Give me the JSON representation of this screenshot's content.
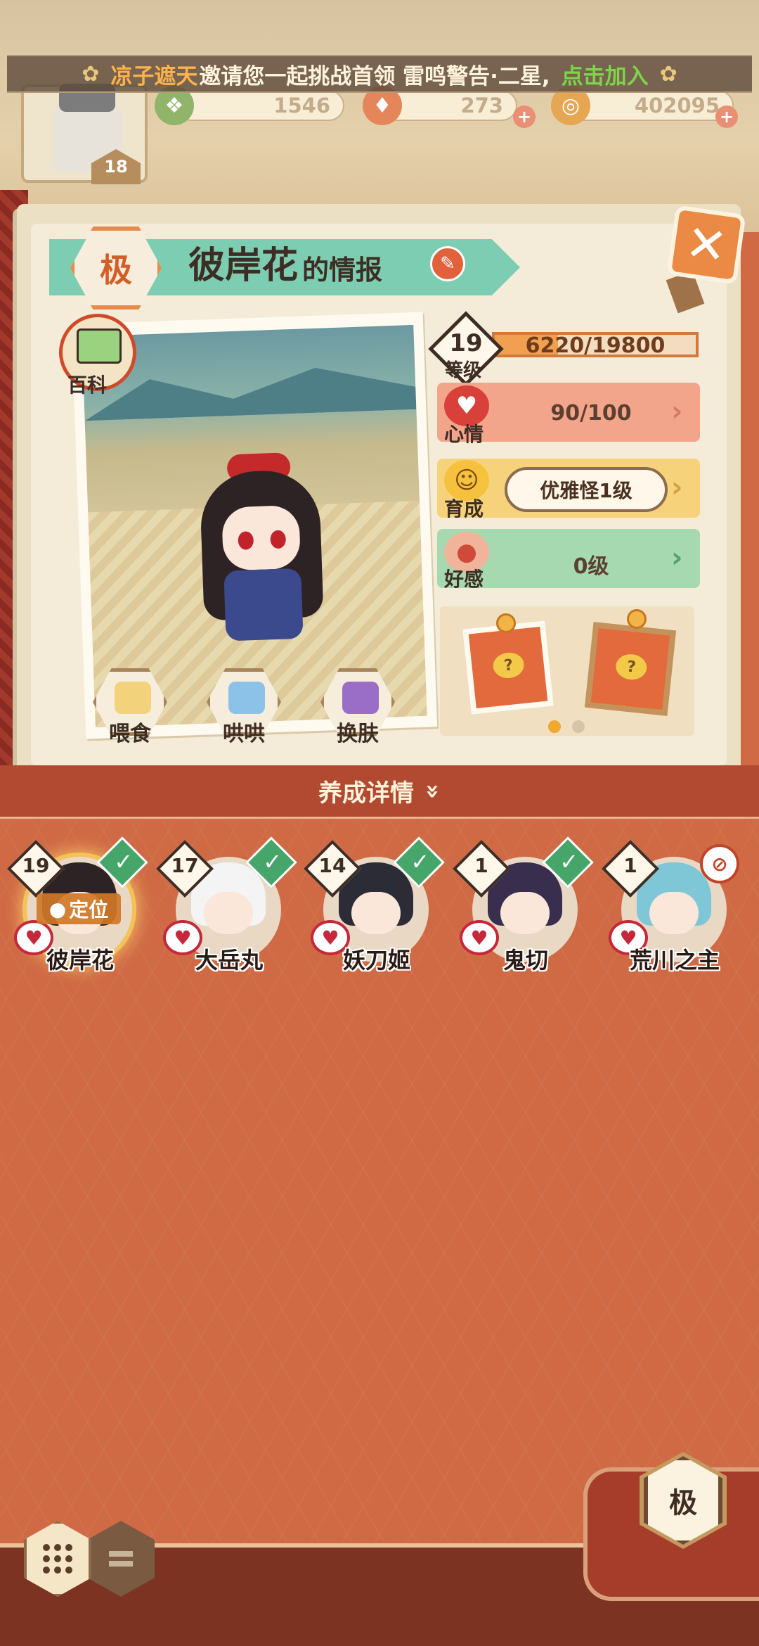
{
  "banner": {
    "inviter": "凉子遮天",
    "message": "邀请您一起挑战首领 雷鸣警告·二星,",
    "action": "点击加入"
  },
  "resources": {
    "player_level": "18",
    "items": [
      {
        "name": "jade",
        "value": "1546",
        "icon": "jade-icon"
      },
      {
        "name": "stamina",
        "value": "273",
        "icon": "stamina-icon"
      },
      {
        "name": "coins",
        "value": "402095",
        "icon": "coin-icon"
      }
    ]
  },
  "profile": {
    "rarity_badge": "极",
    "name": "彼岸花",
    "title_suffix": "的情报",
    "encyclopedia_label": "百科",
    "actions": [
      {
        "label": "喂食",
        "icon": "ramen-icon"
      },
      {
        "label": "哄哄",
        "icon": "milk-icon"
      },
      {
        "label": "换肤",
        "icon": "skin-icon"
      }
    ]
  },
  "stats": {
    "level": "19",
    "level_label": "等级",
    "exp_text": "6220/19800",
    "exp_fraction": 0.314,
    "mood_label": "心情",
    "mood_value": "90/100",
    "nurture_label": "育成",
    "nurture_value": "优雅怪1级",
    "affection_label": "好感",
    "affection_value": "0级",
    "colors": {
      "mood_bg": "#f2a58a",
      "nurture_bg": "#f6d37a",
      "affection_bg": "#a6d9b0"
    }
  },
  "gifts": {
    "page_count": 2,
    "active_page": 0
  },
  "details": {
    "label": "养成详情"
  },
  "roster": [
    {
      "name": "彼岸花",
      "level": "19",
      "status": "check",
      "selected": true,
      "hair": "#2e2324"
    },
    {
      "name": "大岳丸",
      "level": "17",
      "status": "check",
      "selected": false,
      "hair": "#f4f4f4"
    },
    {
      "name": "妖刀姬",
      "level": "14",
      "status": "check",
      "selected": false,
      "hair": "#2c2c36"
    },
    {
      "name": "鬼切",
      "level": "1",
      "status": "check",
      "selected": false,
      "hair": "#3a2e4e"
    },
    {
      "name": "荒川之主",
      "level": "1",
      "status": "locked",
      "selected": false,
      "hair": "#7fc6d6"
    }
  ],
  "roster_locate_label": "定位",
  "bottom": {
    "rarity_button": "极"
  }
}
